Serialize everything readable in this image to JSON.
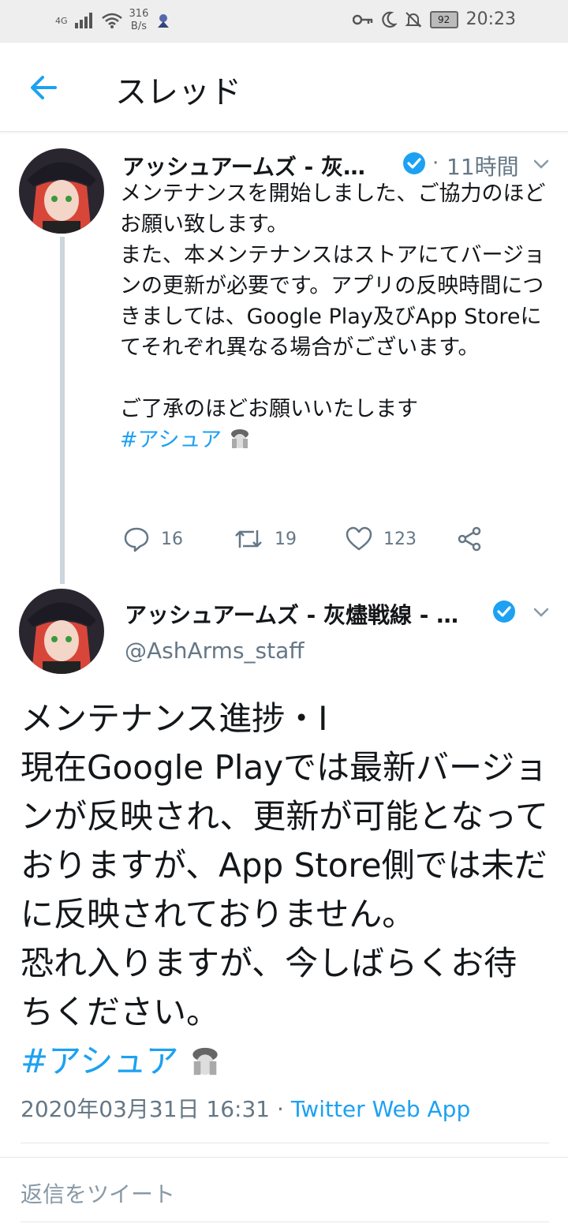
{
  "status_bar": {
    "network": "4G",
    "speed_value": "316",
    "speed_unit": "B/s",
    "battery": "92",
    "time": "20:23"
  },
  "app_bar": {
    "title": "スレッド"
  },
  "tweet1": {
    "author": "アッシュアームズ - 灰…",
    "dot": "·",
    "time_ago": "11時間",
    "text": "メンテナンスを開始しました、ご協力のほどお願い致します。\nまた、本メンテナンスはストアにてバージョンの更新が必要です。アプリの反映時間につきましては、Google Play及びApp Storeにてそれぞれ異なる場合がございます。\n\nご了承のほどお願いいたします",
    "hashtag": "#アシュア",
    "replies": "16",
    "retweets": "19",
    "likes": "123"
  },
  "tweet2": {
    "author": "アッシュアームズ - 灰燼戦線 - …",
    "handle": "@AshArms_staff",
    "text": "メンテナンス進捗・Ⅰ\n現在Google Playでは最新バージョンが反映され、更新が可能となっておりますが、App Store側では未だに反映されておりません。\n恐れ入りますが、今しばらくお待ちください。",
    "hashtag": "#アシュア",
    "date": "2020年03月31日 16:31",
    "dot": "·",
    "app": "Twitter Web App"
  },
  "reply": {
    "placeholder": "返信をツイート"
  },
  "colors": {
    "accent": "#1da1f2",
    "muted": "#657786",
    "border": "#e1e8ed"
  },
  "icons": [
    "back-arrow-icon",
    "verified-icon",
    "chevron-down-icon",
    "reply-icon",
    "retweet-icon",
    "like-icon",
    "share-icon",
    "key-icon",
    "moon-icon",
    "mute-icon",
    "wifi-icon",
    "signal-icon"
  ]
}
